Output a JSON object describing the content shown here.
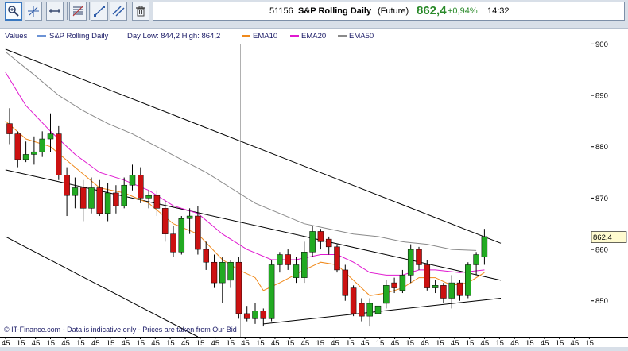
{
  "toolbar": {
    "icons": [
      "zoom-icon",
      "crosshair-icon",
      "horizontal-line-icon",
      "fibonacci-icon",
      "trendline-icon",
      "parallel-lines-icon",
      "trash-icon"
    ]
  },
  "header": {
    "code": "51156",
    "name": "S&P Rolling Daily",
    "type": "(Future)",
    "price": "862,4",
    "change": "+0,94%",
    "time": "14:32",
    "colors": {
      "price": "#2a8a2a",
      "change": "#2a8a2a"
    }
  },
  "legend": {
    "values_label": "Values",
    "instrument": "S&P Rolling Daily",
    "day_range": "Day Low: 844,2  High: 864,2",
    "ema10": "EMA10",
    "ema20": "EMA20",
    "ema50": "EMA50"
  },
  "footer": {
    "copyright": "© IT-Finance.com - Data is indicative only - Prices are taken from Our Bid"
  },
  "chart_data": {
    "type": "candlestick",
    "ylim": [
      843,
      903
    ],
    "y_ticks": [
      850,
      860,
      870,
      880,
      890,
      900
    ],
    "x_tick_labels": [
      "45",
      "15",
      "45",
      "15",
      "45",
      "15",
      "45",
      "15",
      "45",
      "15",
      "45",
      "15",
      "45",
      "15",
      "45",
      "15",
      "45",
      "15",
      "45",
      "15",
      "45",
      "15",
      "45",
      "15",
      "45",
      "15",
      "45",
      "15",
      "45",
      "15",
      "45",
      "15",
      "45",
      "15",
      "45",
      "15",
      "45",
      "15",
      "45",
      "15"
    ],
    "last_price_label": "862,4",
    "colors": {
      "up": "#22aa22",
      "down": "#cc1111",
      "ema10": "#f08a1c",
      "ema20": "#e018d0",
      "ema50": "#8a8a8a",
      "trendline": "#000000",
      "price_tag": "#fffbd0"
    },
    "candles": [
      [
        0,
        884.5,
        882.5,
        887.5,
        880.5
      ],
      [
        1,
        882.5,
        877.5,
        883,
        876
      ],
      [
        2,
        877.5,
        878.5,
        881,
        877
      ],
      [
        3,
        878.5,
        879,
        882,
        876.5
      ],
      [
        4,
        879,
        881.5,
        883,
        878
      ],
      [
        5,
        881.5,
        882.5,
        886.5,
        879
      ],
      [
        6,
        882.5,
        874.5,
        884,
        873.5
      ],
      [
        7,
        874.5,
        870.5,
        876,
        866.5
      ],
      [
        8,
        870.5,
        872,
        874,
        868
      ],
      [
        9,
        872,
        868,
        873.5,
        865.5
      ],
      [
        10,
        868,
        872,
        874,
        867
      ],
      [
        11,
        872,
        867,
        873.5,
        866.5
      ],
      [
        12,
        867,
        871,
        873,
        865.5
      ],
      [
        13,
        871,
        868.5,
        872.5,
        867
      ],
      [
        14,
        868.5,
        872.5,
        874,
        868
      ],
      [
        15,
        872.5,
        874.5,
        876.5,
        871.5
      ],
      [
        16,
        874.5,
        870,
        876,
        869
      ],
      [
        17,
        870,
        870.5,
        871.5,
        868
      ],
      [
        18,
        870.5,
        868,
        871.5,
        866.5
      ],
      [
        19,
        868,
        863,
        869.5,
        861.5
      ],
      [
        20,
        863,
        859.5,
        864.5,
        858.5
      ],
      [
        21,
        859.5,
        866,
        866.5,
        859
      ],
      [
        22,
        866,
        866.5,
        868,
        863
      ],
      [
        23,
        866.5,
        860,
        868.5,
        859
      ],
      [
        24,
        860,
        857.5,
        861.5,
        856
      ],
      [
        25,
        857.5,
        853.5,
        859,
        852.5
      ],
      [
        26,
        853.5,
        857.5,
        858.5,
        849.5
      ],
      [
        27,
        854,
        857.5,
        858,
        852.5
      ],
      [
        28,
        857.5,
        847.5,
        858.5,
        846.5
      ],
      [
        29,
        847.5,
        846.5,
        849,
        846
      ],
      [
        30,
        846.5,
        848,
        849.5,
        845.5
      ],
      [
        31,
        848,
        846.5,
        848.5,
        845
      ],
      [
        32,
        846.5,
        857,
        858,
        846
      ],
      [
        33,
        857,
        859,
        859.5,
        855.5
      ],
      [
        34,
        859,
        857,
        860,
        856
      ],
      [
        35,
        854.5,
        857,
        858.5,
        853.5
      ],
      [
        36,
        854.5,
        859.5,
        861.5,
        853.5
      ],
      [
        37,
        859.5,
        863.5,
        864.5,
        858.5
      ],
      [
        38,
        863.5,
        861.5,
        864,
        860
      ],
      [
        39,
        862,
        860.5,
        862.5,
        859
      ],
      [
        40,
        860.5,
        856,
        861,
        855.5
      ],
      [
        41,
        856,
        851,
        857,
        850
      ],
      [
        42,
        852.5,
        847.5,
        853,
        847
      ],
      [
        43,
        849.5,
        847,
        850.5,
        846
      ],
      [
        44,
        847,
        849.5,
        850.5,
        845
      ],
      [
        45,
        847.5,
        849,
        850,
        846.5
      ],
      [
        46,
        849.5,
        853,
        854,
        848.5
      ],
      [
        47,
        853.5,
        852.5,
        854.5,
        851.5
      ],
      [
        48,
        852,
        855,
        856,
        851.5
      ],
      [
        49,
        855,
        860,
        861,
        853.5
      ],
      [
        50,
        860,
        857,
        860.5,
        856
      ],
      [
        51,
        857,
        852.5,
        858,
        852
      ],
      [
        52,
        852.5,
        853,
        854,
        851.5
      ],
      [
        53,
        853,
        850.5,
        853.5,
        849.5
      ],
      [
        54,
        850.5,
        853.5,
        855,
        848.5
      ],
      [
        55,
        853.5,
        851,
        854,
        850
      ],
      [
        56,
        851,
        857,
        857.5,
        850.5
      ],
      [
        57,
        857,
        859,
        859.5,
        855
      ],
      [
        58,
        858.5,
        862.5,
        864,
        857
      ]
    ],
    "ema10": [
      [
        -0.5,
        885
      ],
      [
        2,
        881.5
      ],
      [
        5,
        880
      ],
      [
        8,
        876
      ],
      [
        11,
        872
      ],
      [
        14,
        871
      ],
      [
        17,
        869
      ],
      [
        20,
        865
      ],
      [
        23,
        863
      ],
      [
        26,
        858
      ],
      [
        28,
        856
      ],
      [
        30,
        854.5
      ],
      [
        31,
        852
      ],
      [
        33,
        853.5
      ],
      [
        36,
        856
      ],
      [
        38,
        857.5
      ],
      [
        40,
        857
      ],
      [
        42,
        854
      ],
      [
        44,
        851
      ],
      [
        46,
        851.5
      ],
      [
        48,
        852.5
      ],
      [
        50,
        854.5
      ],
      [
        52,
        854.5
      ],
      [
        54,
        853
      ],
      [
        56,
        853.5
      ],
      [
        58,
        855.5
      ]
    ],
    "ema20": [
      [
        -0.5,
        894.5
      ],
      [
        2,
        888
      ],
      [
        5,
        883
      ],
      [
        8,
        878.5
      ],
      [
        11,
        875
      ],
      [
        14,
        873.5
      ],
      [
        17,
        871.5
      ],
      [
        20,
        868.5
      ],
      [
        23,
        867
      ],
      [
        26,
        863
      ],
      [
        29,
        860
      ],
      [
        32,
        858
      ],
      [
        35,
        858
      ],
      [
        38,
        859
      ],
      [
        40,
        859
      ],
      [
        42,
        857.5
      ],
      [
        44,
        855.5
      ],
      [
        46,
        855
      ],
      [
        48,
        855
      ],
      [
        50,
        856
      ],
      [
        52,
        856
      ],
      [
        55,
        855.5
      ],
      [
        58,
        856
      ]
    ],
    "ema50": [
      [
        -0.5,
        898.5
      ],
      [
        3,
        894
      ],
      [
        6,
        890
      ],
      [
        9,
        887
      ],
      [
        12,
        884.5
      ],
      [
        15,
        882.5
      ],
      [
        18,
        880
      ],
      [
        21,
        877.5
      ],
      [
        24,
        875
      ],
      [
        27,
        872
      ],
      [
        30,
        869
      ],
      [
        33,
        867
      ],
      [
        36,
        865
      ],
      [
        39,
        864
      ],
      [
        42,
        863
      ],
      [
        45,
        862.5
      ],
      [
        48,
        861.5
      ],
      [
        51,
        861
      ],
      [
        54,
        860
      ],
      [
        57,
        859.8
      ]
    ],
    "trendlines": [
      [
        [
          -0.5,
          899
        ],
        [
          60,
          861.2
        ]
      ],
      [
        [
          -0.5,
          875.5
        ],
        [
          60,
          854
        ]
      ],
      [
        [
          -0.5,
          862.5
        ],
        [
          23,
          843
        ]
      ],
      [
        [
          31,
          845.5
        ],
        [
          60,
          850.5
        ]
      ]
    ]
  }
}
